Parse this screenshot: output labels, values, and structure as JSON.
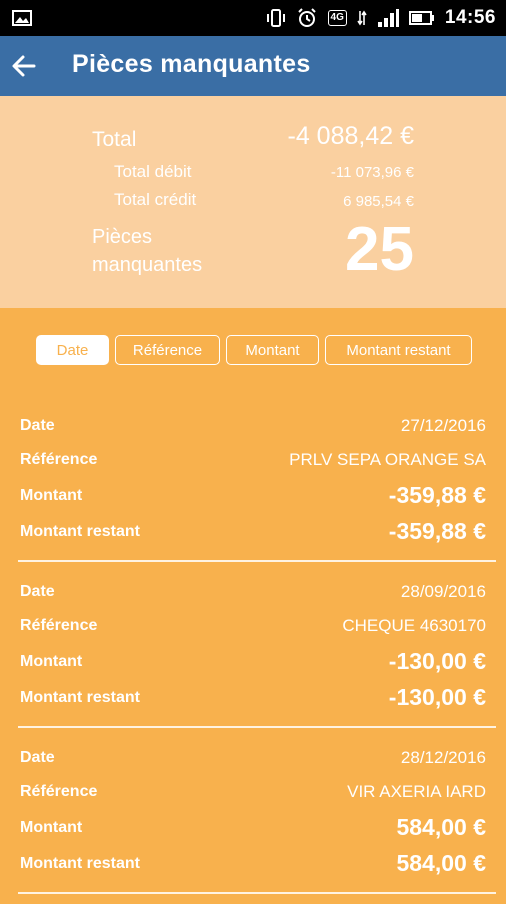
{
  "status_bar": {
    "network": "4G",
    "time": "14:56"
  },
  "app_bar": {
    "title": "Pièces manquantes"
  },
  "summary": {
    "total_label": "Total",
    "total_value": "-4 088,42 €",
    "debit_label": "Total débit",
    "debit_value": "-11 073,96 €",
    "credit_label": "Total crédit",
    "credit_value": "6 985,54 €",
    "missing_label_line1": "Pièces",
    "missing_label_line2": "manquantes",
    "missing_count": "25"
  },
  "sort_tabs": [
    {
      "label": "Date",
      "active": true
    },
    {
      "label": "Référence",
      "active": false
    },
    {
      "label": "Montant",
      "active": false
    },
    {
      "label": "Montant restant",
      "active": false
    }
  ],
  "labels": {
    "date": "Date",
    "reference": "Référence",
    "amount": "Montant",
    "remaining": "Montant restant"
  },
  "entries": [
    {
      "date": "27/12/2016",
      "reference": "PRLV SEPA ORANGE SA",
      "amount": "-359,88 €",
      "remaining": "-359,88 €"
    },
    {
      "date": "28/09/2016",
      "reference": "CHEQUE 4630170",
      "amount": "-130,00 €",
      "remaining": "-130,00 €"
    },
    {
      "date": "28/12/2016",
      "reference": "VIR AXERIA IARD",
      "amount": "584,00 €",
      "remaining": "584,00 €"
    }
  ]
}
